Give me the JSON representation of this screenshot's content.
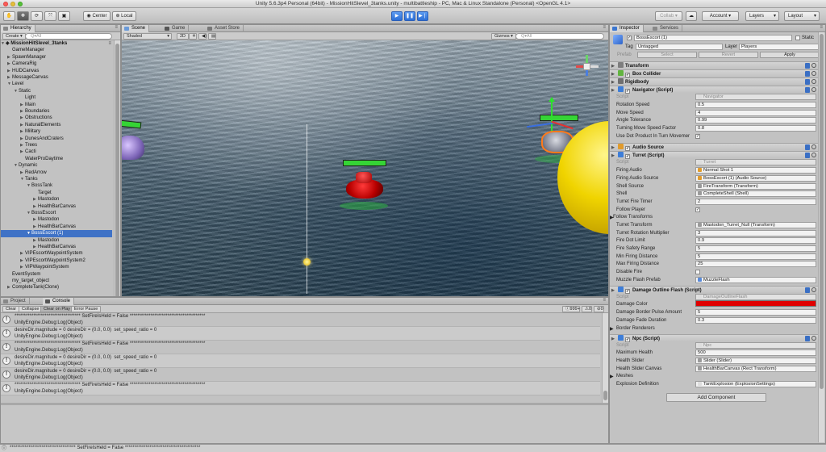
{
  "window": {
    "title": "Unity 5.6.3p4 Personal (64bit) - MissionHitSlevel_3tanks.unity - multibattleship - PC, Mac & Linux Standalone (Personal) <OpenGL 4.1>"
  },
  "toolbar": {
    "pivot_label": "Center",
    "space_label": "Local",
    "collab_label": "Collab ▾",
    "account_label": "Account ▾",
    "layers_label": "Layers",
    "layout_label": "Layout"
  },
  "hierarchy": {
    "tab": "Hierarchy",
    "create_label": "Create ▾",
    "search_placeholder": "Q▾All",
    "scene_name": "MissionHitSlevel_3tanks",
    "items": [
      {
        "label": "GameManager",
        "depth": 1,
        "arrow": ""
      },
      {
        "label": "SpawnManager",
        "depth": 1,
        "arrow": "▶"
      },
      {
        "label": "CameraRig",
        "depth": 1,
        "arrow": "▶"
      },
      {
        "label": "HUDCanvas",
        "depth": 1,
        "arrow": "▶"
      },
      {
        "label": "MessageCanvas",
        "depth": 1,
        "arrow": "▶"
      },
      {
        "label": "Level",
        "depth": 1,
        "arrow": "▼"
      },
      {
        "label": "Static",
        "depth": 2,
        "arrow": "▼"
      },
      {
        "label": "Light",
        "depth": 3,
        "arrow": ""
      },
      {
        "label": "Main",
        "depth": 3,
        "arrow": "▶"
      },
      {
        "label": "Boundaries",
        "depth": 3,
        "arrow": "▶"
      },
      {
        "label": "Obstructions",
        "depth": 3,
        "arrow": "▶"
      },
      {
        "label": "NaturalElements",
        "depth": 3,
        "arrow": "▶"
      },
      {
        "label": "Military",
        "depth": 3,
        "arrow": "▶"
      },
      {
        "label": "DunesAndCraters",
        "depth": 3,
        "arrow": "▶"
      },
      {
        "label": "Trees",
        "depth": 3,
        "arrow": "▶"
      },
      {
        "label": "Cacti",
        "depth": 3,
        "arrow": "▶"
      },
      {
        "label": "WaterProDaytime",
        "depth": 3,
        "arrow": ""
      },
      {
        "label": "Dynamic",
        "depth": 2,
        "arrow": "▼"
      },
      {
        "label": "RedArrow",
        "depth": 3,
        "arrow": "▶"
      },
      {
        "label": "Tanks",
        "depth": 3,
        "arrow": "▼"
      },
      {
        "label": "BossTank",
        "depth": 4,
        "arrow": "▼"
      },
      {
        "label": "Target",
        "depth": 5,
        "arrow": ""
      },
      {
        "label": "Mastodon",
        "depth": 5,
        "arrow": "▶"
      },
      {
        "label": "HealthBarCanvas",
        "depth": 5,
        "arrow": "▶"
      },
      {
        "label": "BossEscort",
        "depth": 4,
        "arrow": "▼"
      },
      {
        "label": "Mastodon",
        "depth": 5,
        "arrow": "▶"
      },
      {
        "label": "HealthBarCanvas",
        "depth": 5,
        "arrow": "▶"
      },
      {
        "label": "BossEscort (1)",
        "depth": 4,
        "arrow": "▼",
        "selected": true
      },
      {
        "label": "Mastodon",
        "depth": 5,
        "arrow": "▶"
      },
      {
        "label": "HealthBarCanvas",
        "depth": 5,
        "arrow": "▶"
      },
      {
        "label": "VIPEscortWaypointSystem",
        "depth": 3,
        "arrow": "▶"
      },
      {
        "label": "VIPEscortWaypointSystem2",
        "depth": 3,
        "arrow": "▶"
      },
      {
        "label": "VIPWaypointSystem",
        "depth": 3,
        "arrow": "▶"
      },
      {
        "label": "EventSystem",
        "depth": 1,
        "arrow": ""
      },
      {
        "label": "my_target_object",
        "depth": 1,
        "arrow": ""
      },
      {
        "label": "CompleteTank(Clone)",
        "depth": 1,
        "arrow": "▶"
      }
    ]
  },
  "scene": {
    "tabs": [
      "Scene",
      "Game",
      "Asset Store"
    ],
    "shading": "Shaded",
    "mode_2d": "2D",
    "gizmos_label": "Gizmos ▾",
    "search_placeholder": "Q▾All"
  },
  "console": {
    "tabs": [
      "Project",
      "Console"
    ],
    "buttons": [
      "Clear",
      "Collapse",
      "Clear on Play",
      "Error Pause"
    ],
    "count_label": "999+",
    "count_warn": "0",
    "count_err": "0",
    "entries": [
      {
        "line1": "*********************************** SetFireIsHeld = False ****************************************",
        "line2": "UnityEngine.Debug:Log(Object)"
      },
      {
        "line1": "desireDir.magnitude = 0 desireDir = (0.0, 0.0)  set_speed_ratio = 0",
        "line2": "UnityEngine.Debug:Log(Object)"
      },
      {
        "line1": "*********************************** SetFireIsHeld = False ****************************************",
        "line2": "UnityEngine.Debug:Log(Object)"
      },
      {
        "line1": "desireDir.magnitude = 0 desireDir = (0.0, 0.0)  set_speed_ratio = 0",
        "line2": "UnityEngine.Debug:Log(Object)"
      },
      {
        "line1": "desireDir.magnitude = 0 desireDir = (0.0, 0.0)  set_speed_ratio = 0",
        "line2": "UnityEngine.Debug:Log(Object)"
      },
      {
        "line1": "*********************************** SetFireIsHeld = False ****************************************",
        "line2": "UnityEngine.Debug:Log(Object)"
      }
    ]
  },
  "status_bar": {
    "text": "*********************************** SetFireIsHeld = False ****************************************"
  },
  "inspector": {
    "tabs": [
      "Inspector",
      "Services"
    ],
    "object_name": "BossEscort (1)",
    "static_label": "Static",
    "tag_label": "Tag",
    "tag_value": "Untagged",
    "layer_label": "Layer",
    "layer_value": "Players",
    "prefab_label": "Prefab",
    "prefab_buttons": [
      "Select",
      "Revert",
      "Apply"
    ],
    "sections": [
      {
        "title": "Transform",
        "color": "#7e7e7e"
      },
      {
        "title": "Box Collider",
        "color": "#62b43f"
      },
      {
        "title": "Rigidbody",
        "color": "#6f6f6f"
      },
      {
        "title": "Navigator (Script)",
        "color": "#3e7ed8"
      },
      {
        "title": "Audio Source",
        "color": "#e09b2d"
      },
      {
        "title": "Turret (Script)",
        "color": "#3e7ed8"
      },
      {
        "title": "Damage Outline Flash (Script)",
        "color": "#3e7ed8"
      },
      {
        "title": "Npc (Script)",
        "color": "#3e7ed8"
      }
    ],
    "navigator": {
      "script_label": "Script",
      "script_value": "Navigator",
      "rows": [
        {
          "label": "Rotation Speed",
          "value": "0.5"
        },
        {
          "label": "Move Speed",
          "value": "4"
        },
        {
          "label": "Angle Tolerance",
          "value": "0.99"
        },
        {
          "label": "Turning Move Speed Factor",
          "value": "0.8"
        }
      ],
      "use_dot_label": "Use Dot Product In Turn Movemer"
    },
    "turret": {
      "script_label": "Script",
      "script_value": "Turret",
      "rows": [
        {
          "label": "Firing Audio",
          "value": "Normal Shot 1"
        },
        {
          "label": "Firing Audio Source",
          "value": "BossEscort (1) (Audio Source)"
        },
        {
          "label": "Shell Source",
          "value": "FireTransform (Transform)"
        },
        {
          "label": "Shell",
          "value": "CompleteShell (Shell)"
        },
        {
          "label": "Turret Fire Timer",
          "value": "2"
        }
      ],
      "follow_player_label": "Follow Player",
      "follow_transforms_label": "Follow Transforms",
      "rows2": [
        {
          "label": "Turret Transform",
          "value": "Mastodon_Turret_Null (Transform)"
        },
        {
          "label": "Turret Rotation Multiplier",
          "value": "3"
        },
        {
          "label": "Fire Dot Limit",
          "value": "0.9"
        },
        {
          "label": "Fire Safety Range",
          "value": "5"
        },
        {
          "label": "Min Firing Distance",
          "value": "5"
        },
        {
          "label": "Max Firing Distance",
          "value": "25"
        }
      ],
      "disable_fire_label": "Disable Fire",
      "muzzle_label": "Muzzle Flash Prefab",
      "muzzle_value": "MuzzleFlash"
    },
    "damage": {
      "script_label": "Script",
      "script_value": "DamageOutlineFlash",
      "color_label": "Damage Color",
      "color_value": "#e00000",
      "rows": [
        {
          "label": "Damage Border Pulse Amount",
          "value": "5"
        },
        {
          "label": "Damage Fade Duration",
          "value": "0.3"
        }
      ],
      "border_label": "Border Renderers"
    },
    "npc": {
      "script_label": "Script",
      "script_value": "Npc",
      "rows": [
        {
          "label": "Maximum Health",
          "value": "500"
        },
        {
          "label": "Health Slider",
          "value": "Slider (Slider)"
        },
        {
          "label": "Health Slider Canvas",
          "value": "HealthBarCanvas (Rect Transform)"
        }
      ],
      "meshes_label": "Meshes",
      "explosion_label": "Explosion Definition",
      "explosion_value": "TankExplosion (ExplosionSettings)"
    },
    "add_component_label": "Add Component"
  }
}
